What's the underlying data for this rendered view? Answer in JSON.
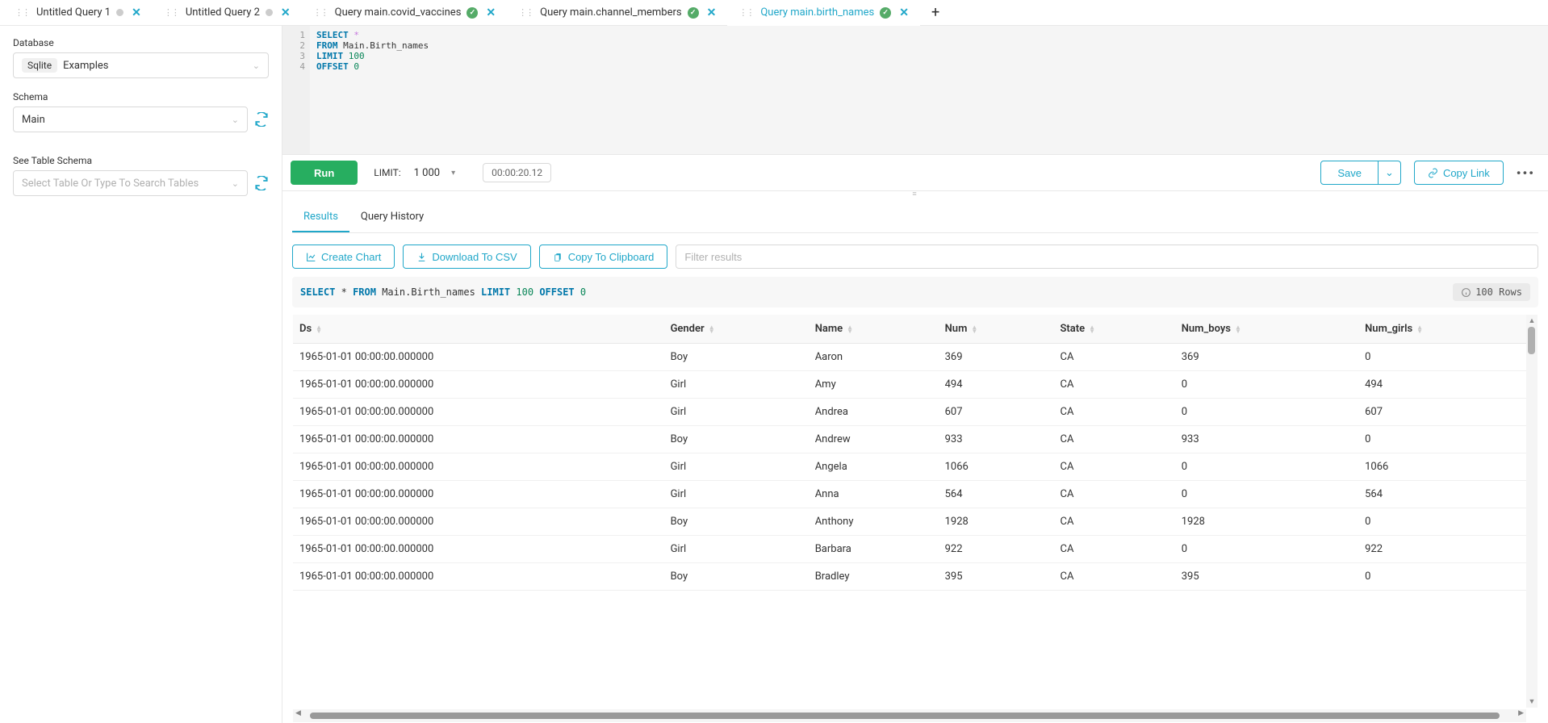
{
  "tabs": [
    {
      "label": "Untitled Query 1",
      "status": "gray",
      "active": false
    },
    {
      "label": "Untitled Query 2",
      "status": "gray",
      "active": false
    },
    {
      "label": "Query main.covid_vaccines",
      "status": "green",
      "active": false
    },
    {
      "label": "Query main.channel_members",
      "status": "green",
      "active": false
    },
    {
      "label": "Query main.birth_names",
      "status": "green",
      "active": true
    }
  ],
  "sidebar": {
    "database_label": "Database",
    "db_engine": "Sqlite",
    "db_name": "Examples",
    "schema_label": "Schema",
    "schema_value": "Main",
    "see_table_label": "See Table Schema",
    "table_placeholder": "Select Table Or Type To Search Tables"
  },
  "editor": {
    "lines": [
      [
        {
          "t": "kw",
          "v": "SELECT"
        },
        {
          "t": "sp",
          "v": " "
        },
        {
          "t": "star",
          "v": "*"
        }
      ],
      [
        {
          "t": "kw",
          "v": "FROM"
        },
        {
          "t": "sp",
          "v": " "
        },
        {
          "t": "id",
          "v": "Main.Birth_names"
        }
      ],
      [
        {
          "t": "kw",
          "v": "LIMIT"
        },
        {
          "t": "sp",
          "v": " "
        },
        {
          "t": "num",
          "v": "100"
        }
      ],
      [
        {
          "t": "kw",
          "v": "OFFSET"
        },
        {
          "t": "sp",
          "v": " "
        },
        {
          "t": "num",
          "v": "0"
        }
      ]
    ]
  },
  "toolbar": {
    "run": "Run",
    "limit_label": "LIMIT:",
    "limit_value": "1 000",
    "timer": "00:00:20.12",
    "save": "Save",
    "copy_link": "Copy Link"
  },
  "subtabs": {
    "results": "Results",
    "history": "Query History"
  },
  "actions": {
    "create_chart": "Create Chart",
    "download_csv": "Download To CSV",
    "copy_clipboard": "Copy To Clipboard",
    "filter_placeholder": "Filter results"
  },
  "sql_display": [
    {
      "t": "kw",
      "v": "SELECT"
    },
    {
      "t": "sp",
      "v": " "
    },
    {
      "t": "star",
      "v": "*"
    },
    {
      "t": "sp",
      "v": " "
    },
    {
      "t": "kw",
      "v": "FROM"
    },
    {
      "t": "sp",
      "v": " "
    },
    {
      "t": "id",
      "v": "Main.Birth_names"
    },
    {
      "t": "sp",
      "v": " "
    },
    {
      "t": "kw",
      "v": "LIMIT"
    },
    {
      "t": "sp",
      "v": " "
    },
    {
      "t": "num",
      "v": "100"
    },
    {
      "t": "sp",
      "v": " "
    },
    {
      "t": "kw",
      "v": "OFFSET"
    },
    {
      "t": "sp",
      "v": " "
    },
    {
      "t": "num",
      "v": "0"
    }
  ],
  "row_count": "100 Rows",
  "columns": [
    "Ds",
    "Gender",
    "Name",
    "Num",
    "State",
    "Num_boys",
    "Num_girls"
  ],
  "rows": [
    [
      "1965-01-01 00:00:00.000000",
      "Boy",
      "Aaron",
      "369",
      "CA",
      "369",
      "0"
    ],
    [
      "1965-01-01 00:00:00.000000",
      "Girl",
      "Amy",
      "494",
      "CA",
      "0",
      "494"
    ],
    [
      "1965-01-01 00:00:00.000000",
      "Girl",
      "Andrea",
      "607",
      "CA",
      "0",
      "607"
    ],
    [
      "1965-01-01 00:00:00.000000",
      "Boy",
      "Andrew",
      "933",
      "CA",
      "933",
      "0"
    ],
    [
      "1965-01-01 00:00:00.000000",
      "Girl",
      "Angela",
      "1066",
      "CA",
      "0",
      "1066"
    ],
    [
      "1965-01-01 00:00:00.000000",
      "Girl",
      "Anna",
      "564",
      "CA",
      "0",
      "564"
    ],
    [
      "1965-01-01 00:00:00.000000",
      "Boy",
      "Anthony",
      "1928",
      "CA",
      "1928",
      "0"
    ],
    [
      "1965-01-01 00:00:00.000000",
      "Girl",
      "Barbara",
      "922",
      "CA",
      "0",
      "922"
    ],
    [
      "1965-01-01 00:00:00.000000",
      "Boy",
      "Bradley",
      "395",
      "CA",
      "395",
      "0"
    ]
  ]
}
